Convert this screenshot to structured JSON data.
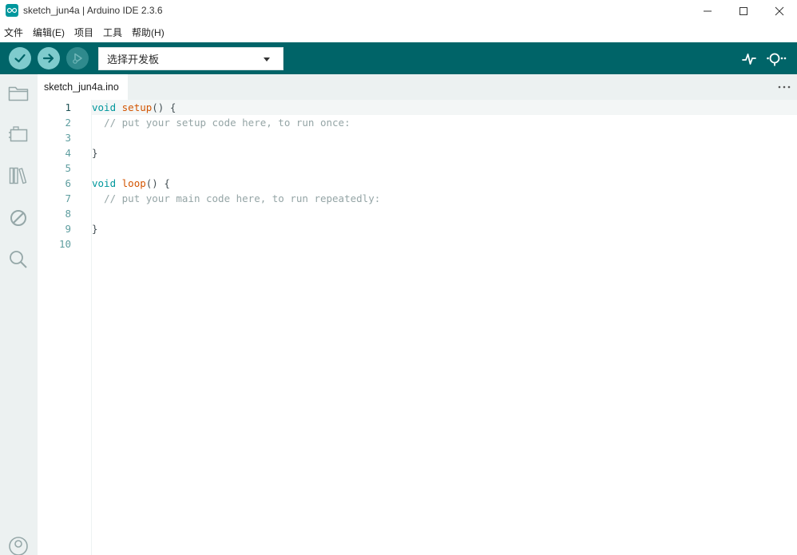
{
  "window": {
    "title": "sketch_jun4a | Arduino IDE 2.3.6"
  },
  "menu": [
    "文件",
    "编辑(E)",
    "项目",
    "工具",
    "帮助(H)"
  ],
  "toolbar": {
    "board_select": "选择开发板"
  },
  "tabs": [
    {
      "label": "sketch_jun4a.ino"
    }
  ],
  "editor": {
    "line_numbers": [
      "1",
      "2",
      "3",
      "4",
      "5",
      "6",
      "7",
      "8",
      "9",
      "10"
    ],
    "active_line": "1",
    "tokens": {
      "l1_kw": "void",
      "l1_fn": "setup",
      "l1_rest": "() {",
      "l2_cm": "// put your setup code here, to run once:",
      "l4": "}",
      "l6_kw": "void",
      "l6_fn": "loop",
      "l6_rest": "() {",
      "l7_cm": "// put your main code here, to run repeatedly:",
      "l9": "}"
    }
  },
  "colors": {
    "toolbar_bg": "#006468",
    "accent": "#00979d",
    "keyword": "#00979c",
    "function": "#d35400",
    "comment": "#95a5a6"
  },
  "icons": {
    "verify": "check-icon",
    "upload": "arrow-right-icon",
    "debug": "debug-play-icon",
    "serial_plotter": "pulse-icon",
    "serial_monitor": "magnifier-dots-icon",
    "sketchbook": "folder-icon",
    "boards_manager": "board-icon",
    "library_manager": "library-icon",
    "debug_panel": "no-entry-icon",
    "search": "search-icon",
    "profile": "user-icon"
  }
}
